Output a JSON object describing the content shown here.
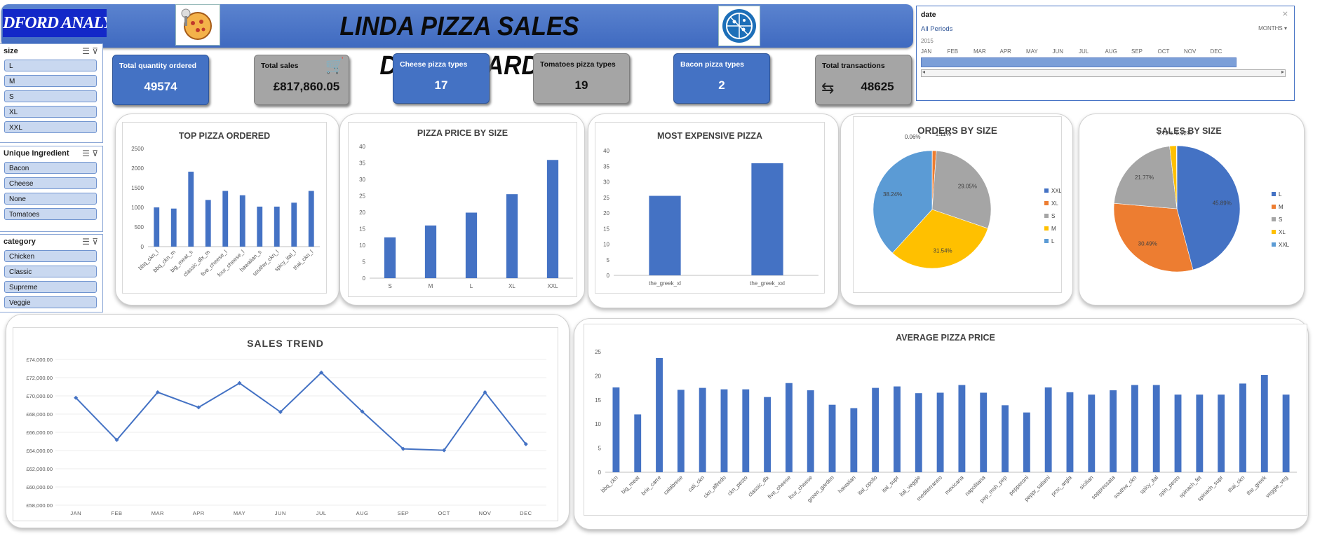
{
  "header": {
    "brand": "DFORD ANALYSTS",
    "title": "LINDA PIZZA SALES DASHBOARD"
  },
  "slicers": {
    "size": {
      "title": "size",
      "items": [
        "L",
        "M",
        "S",
        "XL",
        "XXL"
      ]
    },
    "ingredient": {
      "title": "Unique Ingredient",
      "items": [
        "Bacon",
        "Cheese",
        "None",
        "Tomatoes"
      ]
    },
    "category": {
      "title": "category",
      "items": [
        "Chicken",
        "Classic",
        "Supreme",
        "Veggie"
      ]
    }
  },
  "timeline": {
    "title": "date",
    "period": "All Periods",
    "level": "MONTHS",
    "year": "2015",
    "months": [
      "JAN",
      "FEB",
      "MAR",
      "APR",
      "MAY",
      "JUN",
      "JUL",
      "AUG",
      "SEP",
      "OCT",
      "NOV",
      "DEC"
    ]
  },
  "kpis": [
    {
      "label": "Total quantity ordered",
      "value": "49574",
      "style": "blue"
    },
    {
      "label": "Total sales",
      "value": "£817,860.05",
      "style": "gray"
    },
    {
      "label": "Cheese pizza types",
      "value": "17",
      "style": "blue"
    },
    {
      "label": "Tomatoes pizza types",
      "value": "19",
      "style": "gray"
    },
    {
      "label": "Bacon pizza types",
      "value": "2",
      "style": "blue"
    },
    {
      "label": "Total transactions",
      "value": "48625",
      "style": "gray"
    }
  ],
  "colors": {
    "blue": "#4472c4",
    "orange": "#ed7d31",
    "gray": "#a5a5a5",
    "yellow": "#ffc000",
    "lightblue": "#5b9bd5"
  },
  "chart_data": [
    {
      "type": "bar",
      "title": "TOP PIZZA ORDERED",
      "categories": [
        "bbq_ckn_l",
        "bbq_ckn_m",
        "big_meat_s",
        "classic_dlx_m",
        "five_cheese_l",
        "four_cheese_l",
        "hawaiian_s",
        "southw_ckn_l",
        "spicy_ital_l",
        "thai_ckn_l"
      ],
      "values": [
        1000,
        970,
        1910,
        1190,
        1420,
        1310,
        1020,
        1020,
        1120,
        1420
      ],
      "yticks": [
        0,
        500,
        1000,
        1500,
        2000,
        2500
      ],
      "ylim": [
        0,
        2500
      ]
    },
    {
      "type": "bar",
      "title": "PIZZA PRICE BY SIZE",
      "categories": [
        "S",
        "M",
        "L",
        "XL",
        "XXL"
      ],
      "values": [
        12.4,
        16.0,
        19.9,
        25.5,
        35.9
      ],
      "yticks": [
        0,
        5,
        10,
        15,
        20,
        25,
        30,
        35,
        40
      ],
      "ylim": [
        0,
        40
      ]
    },
    {
      "type": "bar",
      "title": "MOST EXPENSIVE PIZZA",
      "categories": [
        "the_greek_xl",
        "the_greek_xxl"
      ],
      "values": [
        25.5,
        35.95
      ],
      "yticks": [
        0,
        5,
        10,
        15,
        20,
        25,
        30,
        35,
        40
      ],
      "ylim": [
        0,
        40
      ]
    },
    {
      "type": "pie",
      "title": "ORDERS BY SIZE",
      "slices": [
        {
          "name": "XXL",
          "value": 0.06,
          "label": "0.06%",
          "color": "#4472c4"
        },
        {
          "name": "XL",
          "value": 1.11,
          "label": "1.11%",
          "color": "#ed7d31"
        },
        {
          "name": "S",
          "value": 29.05,
          "label": "29.05%",
          "color": "#a5a5a5"
        },
        {
          "name": "M",
          "value": 31.54,
          "label": "31.54%",
          "color": "#ffc000"
        },
        {
          "name": "L",
          "value": 38.24,
          "label": "38.24%",
          "color": "#5b9bd5"
        }
      ],
      "legend": [
        "XXL",
        "XL",
        "S",
        "M",
        "L"
      ]
    },
    {
      "type": "pie",
      "title": "SALES BY SIZE",
      "slices": [
        {
          "name": "L",
          "value": 45.89,
          "label": "45.89%",
          "color": "#4472c4"
        },
        {
          "name": "M",
          "value": 30.49,
          "label": "30.49%",
          "color": "#ed7d31"
        },
        {
          "name": "S",
          "value": 21.77,
          "label": "21.77%",
          "color": "#a5a5a5"
        },
        {
          "name": "XL",
          "value": 1.72,
          "label": "1.72%",
          "color": "#ffc000"
        },
        {
          "name": "XXL",
          "value": 0.12,
          "label": "0.12%",
          "color": "#5b9bd5"
        }
      ],
      "legend": [
        "L",
        "M",
        "S",
        "XL",
        "XXL"
      ]
    },
    {
      "type": "line",
      "title": "SALES TREND",
      "categories": [
        "JAN",
        "FEB",
        "MAR",
        "APR",
        "MAY",
        "JUN",
        "JUL",
        "AUG",
        "SEP",
        "OCT",
        "NOV",
        "DEC"
      ],
      "values": [
        69793,
        65160,
        70397,
        68737,
        71403,
        68230,
        72558,
        68278,
        64180,
        64028,
        70395,
        64701
      ],
      "yticks": [
        "£58,000.00",
        "£60,000.00",
        "£62,000.00",
        "£64,000.00",
        "£66,000.00",
        "£68,000.00",
        "£70,000.00",
        "£72,000.00",
        "£74,000.00"
      ],
      "ylim": [
        58000,
        74000
      ]
    },
    {
      "type": "bar",
      "title": "AVERAGE PIZZA PRICE",
      "categories": [
        "bbq_ckn",
        "big_meat",
        "brie_carre",
        "calabrese",
        "cali_ckn",
        "ckn_alfredo",
        "ckn_pesto",
        "classic_dlx",
        "five_cheese",
        "four_cheese",
        "green_garden",
        "hawaiian",
        "ital_cpcllo",
        "ital_supr",
        "ital_veggie",
        "mediterraneo",
        "mexicana",
        "napolitana",
        "pep_msh_pep",
        "pepperoni",
        "peppr_salami",
        "prsc_argla",
        "sicilian",
        "soppressata",
        "southw_ckn",
        "spicy_ital",
        "spin_pesto",
        "spinach_fet",
        "spinach_supr",
        "thai_ckn",
        "the_greek",
        "veggie_veg"
      ],
      "values": [
        17.6,
        12.0,
        23.7,
        17.1,
        17.5,
        17.2,
        17.2,
        15.6,
        18.5,
        17.0,
        14.0,
        13.3,
        17.5,
        17.8,
        16.4,
        16.5,
        18.1,
        16.5,
        13.9,
        12.4,
        17.6,
        16.6,
        16.1,
        17.0,
        18.1,
        18.1,
        16.1,
        16.1,
        16.1,
        18.4,
        20.2,
        16.1
      ],
      "yticks": [
        0,
        5,
        10,
        15,
        20,
        25
      ],
      "ylim": [
        0,
        25
      ]
    }
  ]
}
